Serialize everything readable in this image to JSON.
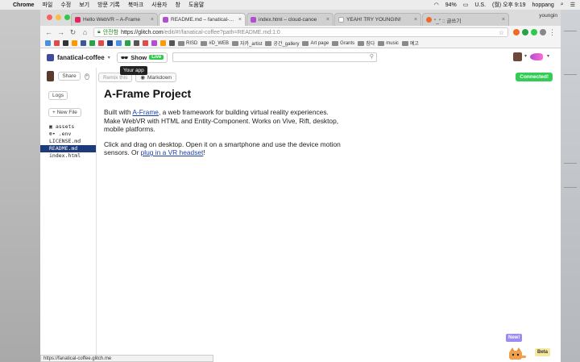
{
  "menubar": {
    "app": "Chrome",
    "items": [
      "파일",
      "수정",
      "보기",
      "방문 기록",
      "북마크",
      "사용자",
      "창",
      "도움말"
    ],
    "battery": "94%",
    "input": "U.S.",
    "clock": "(월) 오후 9:19",
    "user": "hoppang"
  },
  "browser": {
    "profile": "youngin",
    "tabs": [
      {
        "title": "Hello WebVR – A-Frame",
        "color": "#e0245e"
      },
      {
        "title": "README.md – fanatical-coffe",
        "color": "#b24fd0"
      },
      {
        "title": "index.html – cloud-canoe",
        "color": "#b24fd0"
      },
      {
        "title": "YEAH! TRY YOUNGIN!",
        "color": "#ffffff"
      },
      {
        "title": "\"_\" :: 글쓰기",
        "color": "#f06a27"
      }
    ],
    "url_secure": "안전함",
    "url_host": "https://glitch.com",
    "url_path": "/edit/#!/fanatical-coffee?path=README.md:1:0",
    "bookmarks": [
      "RISD",
      "#D_WEB",
      "자카_artist",
      "공간_gallery",
      "Art page",
      "Grants",
      "참다",
      "music",
      "예고"
    ]
  },
  "glitch": {
    "project_name": "fanatical-coffee",
    "show_label": "Show",
    "live_label": "Live",
    "tooltip": "Your app",
    "share": "Share",
    "logs": "Logs",
    "new_file": "+ New File",
    "files": [
      "assets",
      "⊕• .env",
      "LICENSE.md",
      "README.md",
      "index.html"
    ],
    "active_file_index": 3,
    "remix_label": "Remix this",
    "markdown_label": "Markdown",
    "status": "Connected!",
    "new_badge": "New!",
    "beta_badge": "Beta",
    "status_url": "https://fanatical-coffee.glitch.me"
  },
  "readme": {
    "title": "A-Frame Project",
    "p1_pre": "Built with ",
    "p1_link": "A-Frame",
    "p1_post": ", a web framework for building virtual reality experiences. Make WebVR with HTML and Entity-Component. Works on Vive, Rift, desktop, mobile platforms.",
    "p2_pre": "Click and drag on desktop. Open it on a smartphone and use the device motion sensors. Or ",
    "p2_link": "plug in a VR headset",
    "p2_post": "!"
  }
}
